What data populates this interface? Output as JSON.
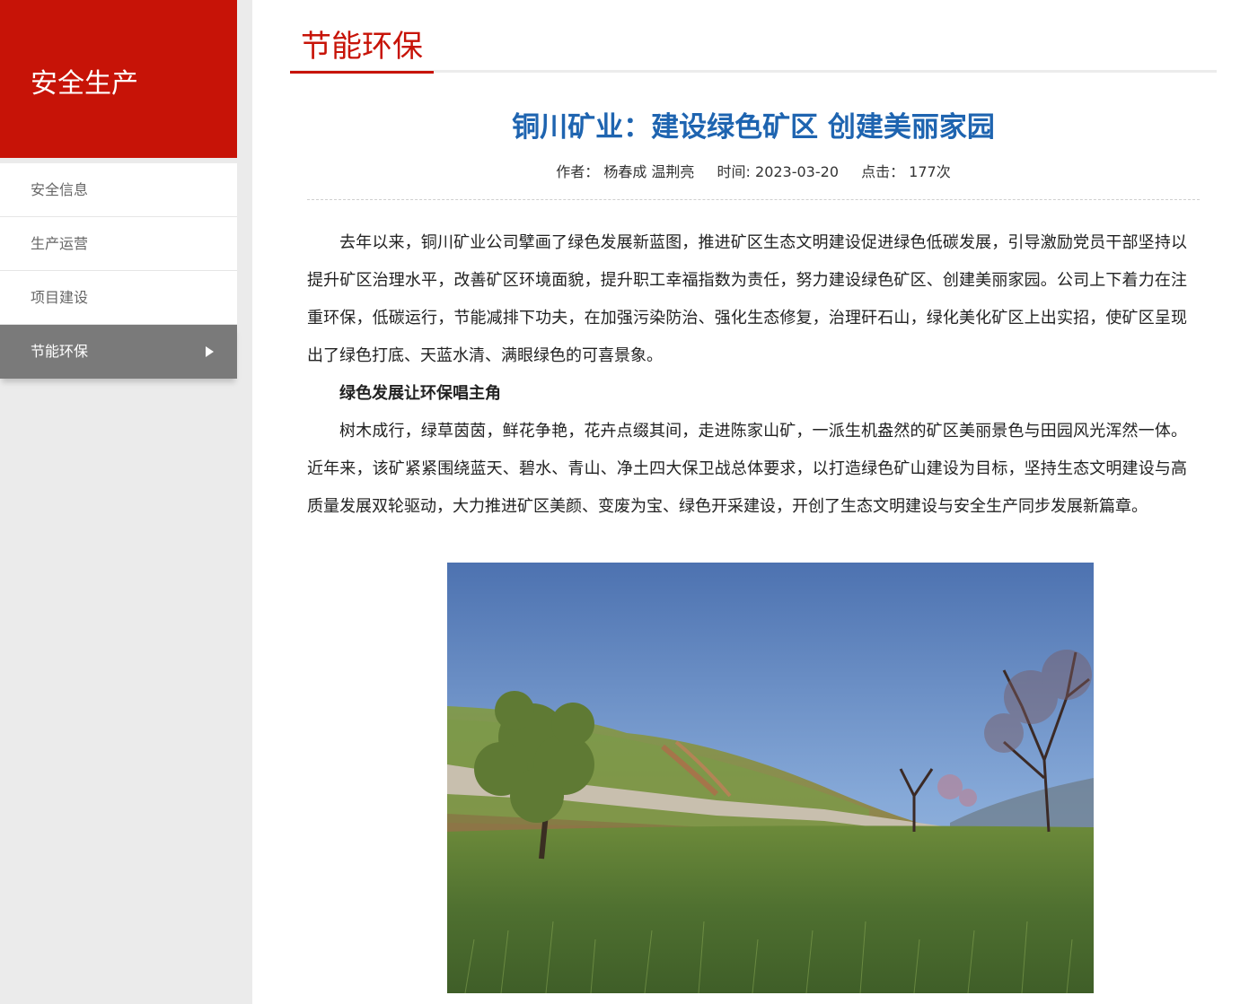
{
  "sidebar": {
    "title": "安全生产",
    "items": [
      {
        "label": "安全信息"
      },
      {
        "label": "生产运营"
      },
      {
        "label": "项目建设"
      },
      {
        "label": "节能环保"
      }
    ]
  },
  "section": {
    "title": "节能环保"
  },
  "article": {
    "title": "铜川矿业：建设绿色矿区 创建美丽家园",
    "author": "作者： 杨春成 温荆亮",
    "time": "时间: 2023-03-20",
    "clicks": "点击： 177次",
    "paragraphs": [
      "去年以来，铜川矿业公司擘画了绿色发展新蓝图，推进矿区生态文明建设促进绿色低碳发展，引导激励党员干部坚持以提升矿区治理水平，改善矿区环境面貌，提升职工幸福指数为责任，努力建设绿色矿区、创建美丽家园。公司上下着力在注重环保，低碳运行，节能减排下功夫，在加强污染防治、强化生态修复，治理矸石山，绿化美化矿区上出实招，使矿区呈现出了绿色打底、天蓝水清、满眼绿色的可喜景象。",
      "绿色发展让环保唱主角",
      "树木成行，绿草茵茵，鲜花争艳，花卉点缀其间，走进陈家山矿，一派生机盎然的矿区美丽景色与田园风光浑然一体。近年来，该矿紧紧围绕蓝天、碧水、青山、净土四大保卫战总体要求，以打造绿色矿山建设为目标，坚持生态文明建设与高质量发展双轮驱动，大力推进矿区美颜、变废为宝、绿色开采建设，开创了生态文明建设与安全生产同步发展新篇章。"
    ]
  },
  "colors": {
    "brand_red": "#c71307",
    "title_blue": "#1e64b0",
    "active_gray": "#7a7a7a"
  }
}
